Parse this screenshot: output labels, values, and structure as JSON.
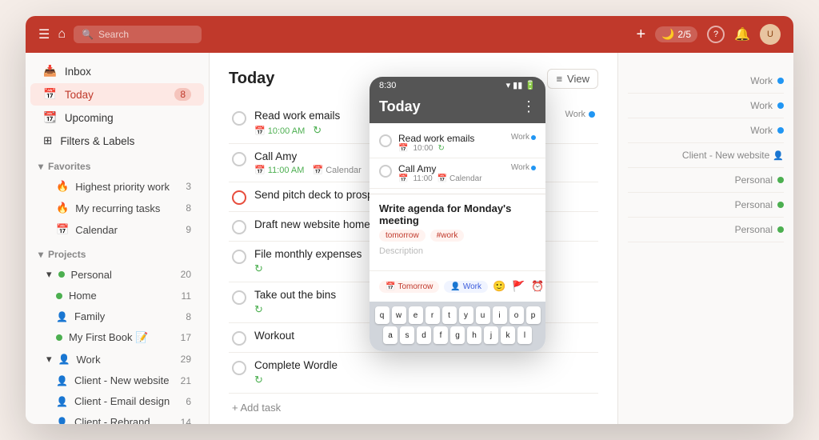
{
  "topbar": {
    "menu_icon": "☰",
    "home_icon": "⌂",
    "search_placeholder": "Search",
    "add_icon": "+",
    "focus_label": "2/5",
    "help_icon": "?",
    "bell_icon": "🔔",
    "avatar_initials": "U"
  },
  "sidebar": {
    "nav_items": [
      {
        "id": "inbox",
        "label": "Inbox",
        "icon": "📥",
        "count": null
      },
      {
        "id": "today",
        "label": "Today",
        "icon": "📅",
        "count": "8",
        "active": true
      },
      {
        "id": "upcoming",
        "label": "Upcoming",
        "icon": "📆",
        "count": null
      },
      {
        "id": "filters",
        "label": "Filters & Labels",
        "icon": "⊞",
        "count": null
      }
    ],
    "favorites_header": "Favorites",
    "favorites": [
      {
        "id": "highest-priority",
        "label": "Highest priority work",
        "icon": "🔥",
        "count": "3"
      },
      {
        "id": "recurring",
        "label": "My recurring tasks",
        "icon": "🔥",
        "count": "8"
      },
      {
        "id": "calendar",
        "label": "Calendar",
        "icon": "📅",
        "count": "9"
      }
    ],
    "projects_header": "Projects",
    "personal_label": "Personal",
    "personal_count": "20",
    "personal_sub": [
      {
        "id": "home",
        "label": "Home",
        "dot": "green",
        "count": "11"
      },
      {
        "id": "family",
        "label": "Family",
        "dot": "blue",
        "count": "8"
      },
      {
        "id": "first-book",
        "label": "My First Book 📝",
        "dot": "green",
        "count": "17"
      }
    ],
    "work_label": "Work",
    "work_count": "29",
    "work_sub": [
      {
        "id": "client-new-website",
        "label": "Client - New website",
        "dot": "person",
        "count": "21"
      },
      {
        "id": "client-email-design",
        "label": "Client - Email design",
        "dot": "person",
        "count": "6"
      },
      {
        "id": "client-rebrand",
        "label": "Client - Rebrand",
        "dot": "person",
        "count": "14"
      }
    ]
  },
  "content": {
    "title": "Today",
    "view_label": "View",
    "tasks": [
      {
        "id": "task1",
        "name": "Read work emails",
        "time": "10:00 AM",
        "time_icon": "📅",
        "calendar": null,
        "priority": false,
        "tag": "Work",
        "tag_dot": "blue"
      },
      {
        "id": "task2",
        "name": "Call Amy",
        "time": "11:00 AM",
        "time_icon": "📅",
        "calendar": "Calendar",
        "priority": false,
        "tag": null
      },
      {
        "id": "task3",
        "name": "Send pitch deck to prospect",
        "time": null,
        "priority": true,
        "tag": null
      },
      {
        "id": "task4",
        "name": "Draft new website homepage",
        "time": null,
        "priority": false,
        "tag": null
      },
      {
        "id": "task5",
        "name": "File monthly expenses",
        "time": null,
        "priority": false,
        "tag": null,
        "has_recur": true
      },
      {
        "id": "task6",
        "name": "Take out the bins",
        "time": null,
        "priority": false,
        "tag": null,
        "has_recur": true
      },
      {
        "id": "task7",
        "name": "Workout",
        "time": null,
        "priority": false,
        "tag": null
      },
      {
        "id": "task8",
        "name": "Complete Wordle",
        "time": null,
        "priority": false,
        "tag": null,
        "has_recur": true
      }
    ],
    "add_task_label": "+ Add task"
  },
  "right_panel": {
    "items": [
      {
        "label": "Work",
        "dot": "blue"
      },
      {
        "label": "Work",
        "dot": "blue"
      },
      {
        "label": "Work",
        "dot": "blue"
      },
      {
        "label": "Client - New website",
        "dot": "person"
      },
      {
        "label": "Personal",
        "dot": "green"
      },
      {
        "label": "Personal",
        "dot": "green"
      },
      {
        "label": "Personal",
        "dot": "green"
      }
    ]
  },
  "mobile": {
    "time": "8:30",
    "title": "Today",
    "tasks": [
      {
        "name": "Read work emails",
        "time": "10:00",
        "tag": "Work"
      },
      {
        "name": "Call Amy",
        "time": "11:00",
        "calendar": "Calendar",
        "tag": "Work"
      }
    ],
    "add_task": {
      "title": "Write agenda for Monday's meeting",
      "tags": [
        "tomorrow",
        "#work"
      ],
      "description": "Description",
      "footer_tag1": "Tomorrow",
      "footer_tag2": "Work"
    },
    "keyboard_rows": [
      [
        "q",
        "w",
        "e",
        "r",
        "t",
        "y",
        "u",
        "i",
        "o",
        "p"
      ],
      [
        "a",
        "s",
        "d",
        "f",
        "g",
        "h",
        "j",
        "k",
        "l"
      ]
    ]
  }
}
